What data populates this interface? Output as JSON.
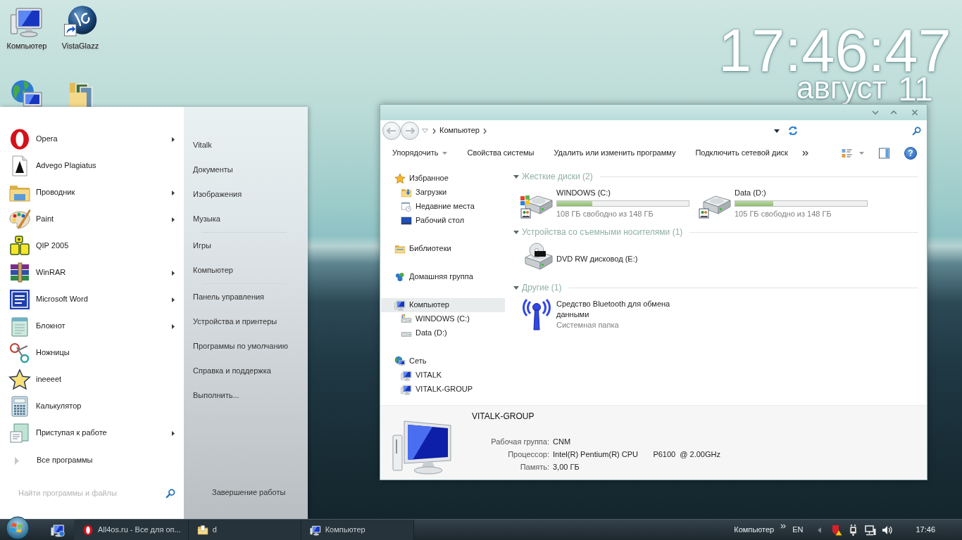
{
  "desktop": {
    "icons": [
      {
        "kind": "computer",
        "label": "Компьютер",
        "shortcut": false
      },
      {
        "kind": "sphere",
        "label": "VistaGlazz",
        "shortcut": true
      },
      {
        "kind": "network",
        "shortcut": false
      },
      {
        "kind": "pictures-folder",
        "shortcut": false
      }
    ]
  },
  "clock_widget": {
    "time": "17:46:47",
    "month": "август",
    "day": "11"
  },
  "start_menu": {
    "programs": [
      {
        "label": "Opera",
        "kind": "opera",
        "submenu": true
      },
      {
        "label": "Advego Plagiatus",
        "kind": "page",
        "submenu": false
      },
      {
        "label": "Проводник",
        "kind": "explorer",
        "submenu": true
      },
      {
        "label": "Paint",
        "kind": "palette",
        "submenu": true
      },
      {
        "label": "QIP 2005",
        "kind": "qip",
        "submenu": false
      },
      {
        "label": "WinRAR",
        "kind": "archive",
        "submenu": true
      },
      {
        "label": "Microsoft Word",
        "kind": "document",
        "submenu": true
      },
      {
        "label": "Блокнот",
        "kind": "notepad",
        "submenu": true
      },
      {
        "label": "Ножницы",
        "kind": "scissors",
        "submenu": false
      },
      {
        "label": "ineeeet",
        "kind": "star",
        "submenu": false
      },
      {
        "label": "Калькулятор",
        "kind": "calculator",
        "submenu": false
      },
      {
        "label": "Приступая к работе",
        "kind": "getting-started",
        "submenu": true
      }
    ],
    "all_programs": "Все программы",
    "search": {
      "placeholder": "Найти программы и файлы"
    },
    "places": [
      {
        "items": [
          "Vitalk",
          "Документы",
          "Изображения",
          "Музыка"
        ]
      },
      {
        "items": [
          "Игры",
          "Компьютер"
        ]
      },
      {
        "items": [
          "Панель управления",
          "Устройства и принтеры",
          "Программы по умолчанию",
          "Справка и поддержка",
          "Выполнить..."
        ]
      }
    ],
    "shutdown": "Завершение работы"
  },
  "explorer": {
    "breadcrumb": [
      "Компьютер"
    ],
    "toolbar": [
      {
        "label": "Упорядочить",
        "dropdown": true
      },
      {
        "label": "Свойства системы",
        "dropdown": false
      },
      {
        "label": "Удалить или изменить программу",
        "dropdown": false
      },
      {
        "label": "Подключить сетевой диск",
        "dropdown": false
      }
    ],
    "help": "?",
    "navigation": [
      {
        "label": "Избранное",
        "kind": "favorites",
        "selected": false,
        "children": [
          {
            "label": "Загрузки",
            "kind": "downloads",
            "selected": false
          },
          {
            "label": "Недавние места",
            "kind": "recent",
            "selected": false
          },
          {
            "label": "Рабочий стол",
            "kind": "desktop",
            "selected": false
          }
        ]
      },
      {
        "label": "Библиотеки",
        "kind": "libraries",
        "selected": false
      },
      {
        "label": "Домашняя группа",
        "kind": "homegroup",
        "selected": false
      },
      {
        "label": "Компьютер",
        "kind": "computer",
        "selected": true,
        "children": [
          {
            "label": "WINDOWS (C:)",
            "kind": "system-drive",
            "selected": false
          },
          {
            "label": "Data (D:)",
            "kind": "drive",
            "selected": false
          }
        ]
      },
      {
        "label": "Сеть",
        "kind": "network",
        "selected": false,
        "children": [
          {
            "label": "VITALK",
            "kind": "pc",
            "selected": false
          },
          {
            "label": "VITALK-GROUP",
            "kind": "pc",
            "selected": false
          }
        ]
      }
    ],
    "groups": [
      {
        "title": "Жесткие диски (2)",
        "items": [
          {
            "kind": "system-drive",
            "name": "WINDOWS (C:)",
            "level": 0.27,
            "free": "108 ГБ свободно из 148 ГБ"
          },
          {
            "kind": "drive",
            "name": "Data (D:)",
            "level": 0.29,
            "free": "105 ГБ свободно из 148 ГБ"
          }
        ]
      },
      {
        "title": "Устройства со съемными носителями (1)",
        "items": [
          {
            "kind": "dvd",
            "name": "DVD RW дисковод (E:)"
          }
        ]
      },
      {
        "title": "Другие (1)",
        "items": [
          {
            "kind": "bluetooth",
            "name": "Средство Bluetooth для обмена данными",
            "subtitle": "Системная папка"
          }
        ]
      }
    ],
    "details": {
      "name": "VITALK-GROUP",
      "fields": [
        {
          "label": "Рабочая группа:",
          "value": "CNM"
        },
        {
          "label": "Процессор:",
          "value": "Intel(R) Pentium(R) CPU       P6100  @ 2.00GHz"
        },
        {
          "label": "Память:",
          "value": "3,00 ГБ"
        }
      ]
    }
  },
  "taskbar": {
    "quick_launch": [
      {
        "kind": "computer-info"
      }
    ],
    "tasks": [
      {
        "kind": "opera",
        "label": "All4os.ru - Все для оп..."
      },
      {
        "kind": "folder",
        "label": "d"
      },
      {
        "kind": "computer",
        "label": "Компьютер"
      }
    ],
    "toolbar_label": "Компьютер",
    "language": "EN",
    "tray": [
      {
        "kind": "antivirus"
      },
      {
        "kind": "power"
      },
      {
        "kind": "network"
      },
      {
        "kind": "volume"
      }
    ],
    "time": "17:46"
  }
}
